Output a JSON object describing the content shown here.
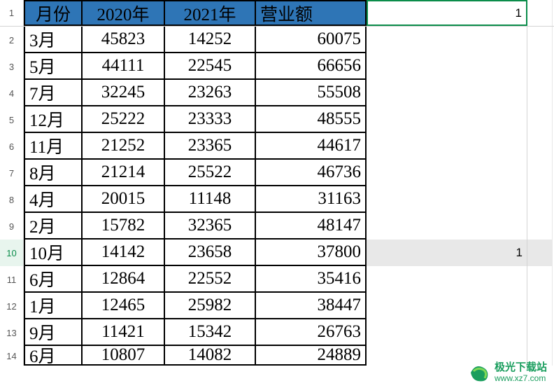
{
  "headers": {
    "month": "月份",
    "year2020": "2020年",
    "year2021": "2021年",
    "revenue": "营业额"
  },
  "extra_col_header": "1",
  "rows": [
    {
      "num": "1",
      "month": "",
      "y2020": "",
      "y2021": "",
      "revenue": "",
      "extra": "1",
      "is_header": true
    },
    {
      "num": "2",
      "month": "3月",
      "y2020": "45823",
      "y2021": "14252",
      "revenue": "60075",
      "extra": ""
    },
    {
      "num": "3",
      "month": "5月",
      "y2020": "44111",
      "y2021": "22545",
      "revenue": "66656",
      "extra": ""
    },
    {
      "num": "4",
      "month": "7月",
      "y2020": "32245",
      "y2021": "23263",
      "revenue": "55508",
      "extra": ""
    },
    {
      "num": "5",
      "month": "12月",
      "y2020": "25222",
      "y2021": "23333",
      "revenue": "48555",
      "extra": ""
    },
    {
      "num": "6",
      "month": "11月",
      "y2020": "21252",
      "y2021": "23365",
      "revenue": "44617",
      "extra": ""
    },
    {
      "num": "7",
      "month": "8月",
      "y2020": "21214",
      "y2021": "25522",
      "revenue": "46736",
      "extra": ""
    },
    {
      "num": "8",
      "month": "4月",
      "y2020": "20015",
      "y2021": "11148",
      "revenue": "31163",
      "extra": ""
    },
    {
      "num": "9",
      "month": "2月",
      "y2020": "15782",
      "y2021": "32365",
      "revenue": "48147",
      "extra": ""
    },
    {
      "num": "10",
      "month": "10月",
      "y2020": "14142",
      "y2021": "23658",
      "revenue": "37800",
      "extra": "1",
      "highlight": true
    },
    {
      "num": "11",
      "month": "6月",
      "y2020": "12864",
      "y2021": "22552",
      "revenue": "35416",
      "extra": ""
    },
    {
      "num": "12",
      "month": "1月",
      "y2020": "12465",
      "y2021": "25982",
      "revenue": "38447",
      "extra": ""
    },
    {
      "num": "13",
      "month": "9月",
      "y2020": "11421",
      "y2021": "15342",
      "revenue": "26763",
      "extra": ""
    },
    {
      "num": "14",
      "month": "6月",
      "y2020": "10807",
      "y2021": "14082",
      "revenue": "24889",
      "extra": ""
    }
  ],
  "watermark": {
    "title": "极光下载站",
    "url": "www.xz7.com"
  }
}
